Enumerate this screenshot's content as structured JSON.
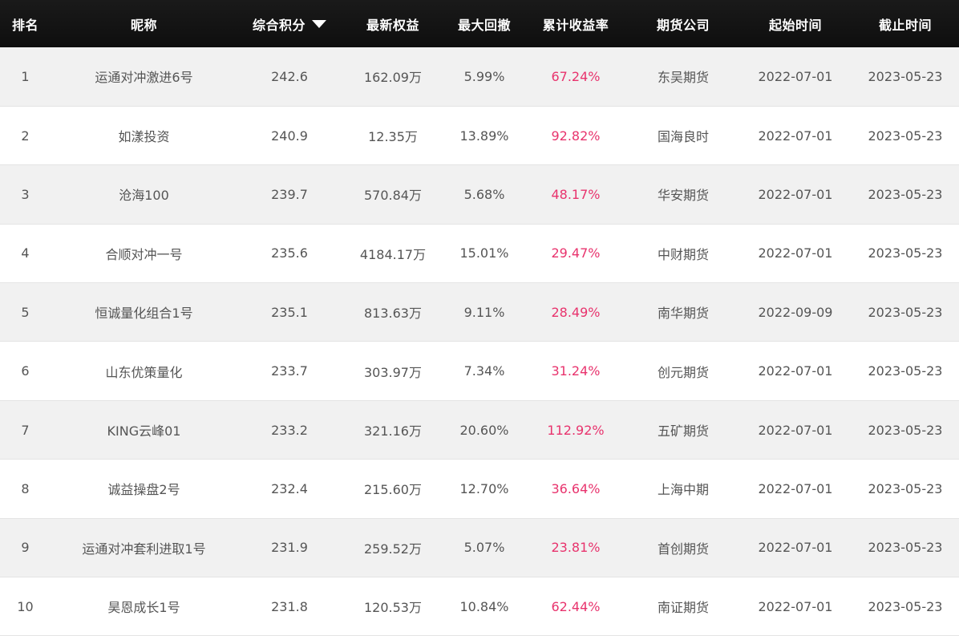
{
  "header": {
    "rank": "排名",
    "nickname": "昵称",
    "score": "综合积分",
    "equity": "最新权益",
    "drawdown": "最大回撤",
    "return": "累计收益率",
    "broker": "期货公司",
    "start": "起始时间",
    "end": "截止时间",
    "sort_icon": "caret-down-icon"
  },
  "colors": {
    "header_bg": "#121212",
    "odd_row_bg": "#f1f1f1",
    "even_row_bg": "#ffffff",
    "text": "#555555",
    "return_rate": "#e8336d"
  },
  "rows": [
    {
      "rank": "1",
      "nickname": "运通对冲激进6号",
      "score": "242.6",
      "equity": "162.09万",
      "drawdown": "5.99%",
      "return": "67.24%",
      "broker": "东吴期货",
      "start": "2022-07-01",
      "end": "2023-05-23"
    },
    {
      "rank": "2",
      "nickname": "如漾投资",
      "score": "240.9",
      "equity": "12.35万",
      "drawdown": "13.89%",
      "return": "92.82%",
      "broker": "国海良时",
      "start": "2022-07-01",
      "end": "2023-05-23"
    },
    {
      "rank": "3",
      "nickname": "沧海100",
      "score": "239.7",
      "equity": "570.84万",
      "drawdown": "5.68%",
      "return": "48.17%",
      "broker": "华安期货",
      "start": "2022-07-01",
      "end": "2023-05-23"
    },
    {
      "rank": "4",
      "nickname": "合顺对冲一号",
      "score": "235.6",
      "equity": "4184.17万",
      "drawdown": "15.01%",
      "return": "29.47%",
      "broker": "中财期货",
      "start": "2022-07-01",
      "end": "2023-05-23"
    },
    {
      "rank": "5",
      "nickname": "恒诚量化组合1号",
      "score": "235.1",
      "equity": "813.63万",
      "drawdown": "9.11%",
      "return": "28.49%",
      "broker": "南华期货",
      "start": "2022-09-09",
      "end": "2023-05-23"
    },
    {
      "rank": "6",
      "nickname": "山东优策量化",
      "score": "233.7",
      "equity": "303.97万",
      "drawdown": "7.34%",
      "return": "31.24%",
      "broker": "创元期货",
      "start": "2022-07-01",
      "end": "2023-05-23"
    },
    {
      "rank": "7",
      "nickname": "KING云峰01",
      "score": "233.2",
      "equity": "321.16万",
      "drawdown": "20.60%",
      "return": "112.92%",
      "broker": "五矿期货",
      "start": "2022-07-01",
      "end": "2023-05-23"
    },
    {
      "rank": "8",
      "nickname": "诚益操盘2号",
      "score": "232.4",
      "equity": "215.60万",
      "drawdown": "12.70%",
      "return": "36.64%",
      "broker": "上海中期",
      "start": "2022-07-01",
      "end": "2023-05-23"
    },
    {
      "rank": "9",
      "nickname": "运通对冲套利进取1号",
      "score": "231.9",
      "equity": "259.52万",
      "drawdown": "5.07%",
      "return": "23.81%",
      "broker": "首创期货",
      "start": "2022-07-01",
      "end": "2023-05-23"
    },
    {
      "rank": "10",
      "nickname": "昊恩成长1号",
      "score": "231.8",
      "equity": "120.53万",
      "drawdown": "10.84%",
      "return": "62.44%",
      "broker": "南证期货",
      "start": "2022-07-01",
      "end": "2023-05-23"
    }
  ]
}
